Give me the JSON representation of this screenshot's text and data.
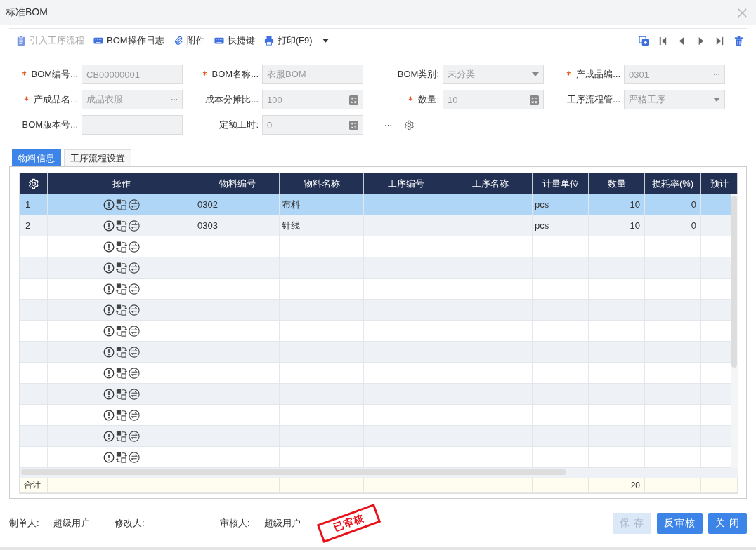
{
  "window": {
    "title": "标准BOM"
  },
  "toolbar": [
    {
      "kind": "clipboard",
      "label": "引入工序流程",
      "disabled": true
    },
    {
      "kind": "keyboard",
      "label": "BOM操作日志",
      "disabled": false
    },
    {
      "kind": "paperclip",
      "label": "附件",
      "disabled": false
    },
    {
      "kind": "keyboard",
      "label": "快捷键",
      "disabled": false
    },
    {
      "kind": "printer",
      "label": "打印(F9)",
      "disabled": false,
      "dropdown": true
    }
  ],
  "form": [
    {
      "label": "BOM编号...",
      "required": true,
      "kind": "text",
      "value": "CB00000001"
    },
    {
      "label": "BOM名称...",
      "required": true,
      "kind": "text",
      "value": "衣服BOM"
    },
    {
      "label": "BOM类别:",
      "required": false,
      "kind": "select",
      "value": "未分类"
    },
    {
      "label": "产成品编...",
      "required": true,
      "kind": "lookup",
      "value": "0301"
    },
    {
      "label": "产成品名...",
      "required": true,
      "kind": "lookup",
      "value": "成品衣服"
    },
    {
      "label": "成本分摊比...",
      "required": false,
      "kind": "number",
      "value": "100"
    },
    {
      "label": "数量:",
      "required": true,
      "kind": "number",
      "value": "10"
    },
    {
      "label": "工序流程管...",
      "required": false,
      "kind": "select",
      "value": "严格工序"
    },
    {
      "label": "BOM版本号...",
      "required": false,
      "kind": "text"
    },
    {
      "label": "定额工时:",
      "required": false,
      "kind": "number",
      "value": "0"
    }
  ],
  "more_button": "···",
  "tabs": [
    {
      "label": "物料信息",
      "selected": true
    },
    {
      "label": "工序流程设置",
      "selected": false
    }
  ],
  "table": {
    "columns": [
      "操作",
      "物料编号",
      "物料名称",
      "工序编号",
      "工序名称",
      "计量单位",
      "数量",
      "损耗率(%)",
      "预计"
    ],
    "rows": [
      {
        "selected": true,
        "no": "1",
        "code": "0302",
        "name": "布料",
        "unit": "pcs",
        "qty": "10",
        "loss": "0"
      },
      {
        "selected": false,
        "no": "2",
        "code": "0303",
        "name": "针线",
        "unit": "pcs",
        "qty": "10",
        "loss": "0"
      },
      {
        "selected": false
      },
      {
        "selected": false
      },
      {
        "selected": false
      },
      {
        "selected": false
      },
      {
        "selected": false
      },
      {
        "selected": false
      },
      {
        "selected": false
      },
      {
        "selected": false
      },
      {
        "selected": false
      },
      {
        "selected": false
      },
      {
        "selected": false
      }
    ],
    "total": {
      "label": "合计",
      "qty": "20"
    }
  },
  "footer": {
    "fields": [
      {
        "label": "制单人:",
        "value": "超级用户"
      },
      {
        "label": "修改人:"
      },
      {
        "label": "审核人:",
        "value": "超级用户"
      }
    ],
    "stamp": "已审核",
    "buttons": [
      {
        "label": "保 存",
        "disabled": true
      },
      {
        "label": "反审核",
        "disabled": false
      },
      {
        "label": "关 闭",
        "disabled": false
      }
    ]
  }
}
